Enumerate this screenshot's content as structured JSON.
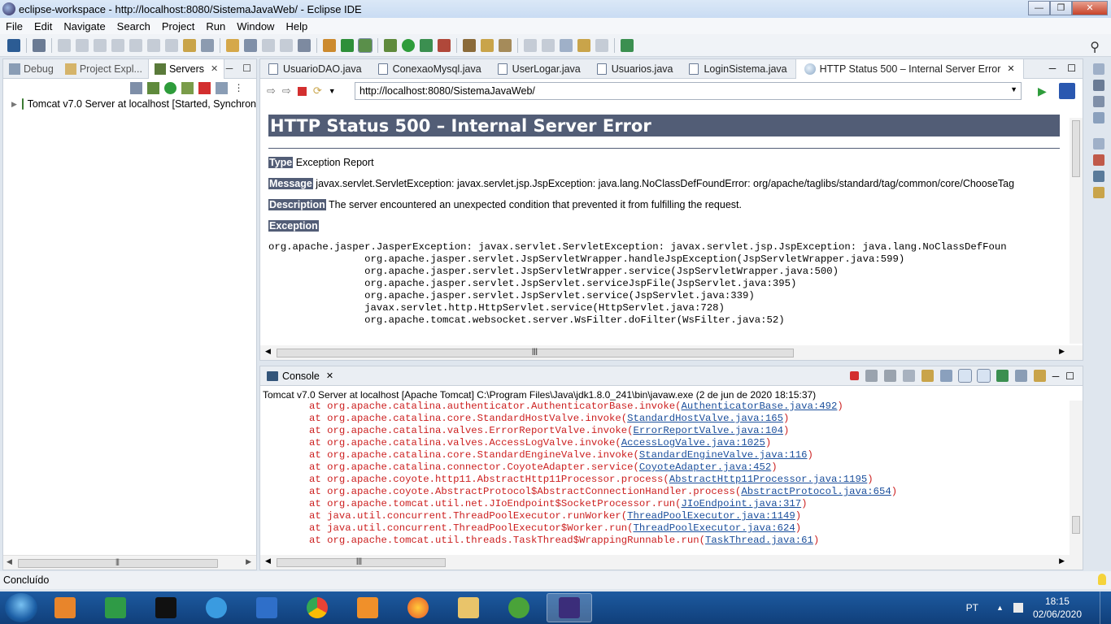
{
  "window": {
    "title": "eclipse-workspace - http://localhost:8080/SistemaJavaWeb/ - Eclipse IDE"
  },
  "menu": [
    "File",
    "Edit",
    "Navigate",
    "Search",
    "Project",
    "Run",
    "Window",
    "Help"
  ],
  "left_panel": {
    "tabs": [
      {
        "label": "Debug",
        "active": false
      },
      {
        "label": "Project Expl...",
        "active": false
      },
      {
        "label": "Servers",
        "active": true
      }
    ],
    "server_item": "Tomcat v7.0 Server at localhost  [Started, Synchron"
  },
  "editor": {
    "tabs": [
      {
        "label": "UsuarioDAO.java"
      },
      {
        "label": "ConexaoMysql.java"
      },
      {
        "label": "UserLogar.java"
      },
      {
        "label": "Usuarios.java"
      },
      {
        "label": "LoginSistema.java"
      },
      {
        "label": "HTTP Status 500 – Internal Server Error",
        "active": true
      }
    ],
    "url": "http://localhost:8080/SistemaJavaWeb/",
    "page": {
      "heading": "HTTP Status 500 – Internal Server Error",
      "type_label": "Type",
      "type_value": "Exception Report",
      "message_label": "Message",
      "message_value": "javax.servlet.ServletException: javax.servlet.jsp.JspException: java.lang.NoClassDefFoundError: org/apache/taglibs/standard/tag/common/core/ChooseTag",
      "description_label": "Description",
      "description_value": "The server encountered an unexpected condition that prevented it from fulfilling the request.",
      "exception_label": "Exception",
      "stack": [
        "org.apache.jasper.JasperException: javax.servlet.ServletException: javax.servlet.jsp.JspException: java.lang.NoClassDefFoun",
        "\torg.apache.jasper.servlet.JspServletWrapper.handleJspException(JspServletWrapper.java:599)",
        "\torg.apache.jasper.servlet.JspServletWrapper.service(JspServletWrapper.java:500)",
        "\torg.apache.jasper.servlet.JspServlet.serviceJspFile(JspServlet.java:395)",
        "\torg.apache.jasper.servlet.JspServlet.service(JspServlet.java:339)",
        "\tjavax.servlet.http.HttpServlet.service(HttpServlet.java:728)",
        "\torg.apache.tomcat.websocket.server.WsFilter.doFilter(WsFilter.java:52)"
      ]
    }
  },
  "console": {
    "tab_label": "Console",
    "title": "Tomcat v7.0 Server at localhost [Apache Tomcat] C:\\Program Files\\Java\\jdk1.8.0_241\\bin\\javaw.exe  (2 de jun de 2020 18:15:37)",
    "lines": [
      {
        "text": "at org.apache.catalina.authenticator.AuthenticatorBase.invoke(",
        "link": "AuthenticatorBase.java:492",
        "tail": ")"
      },
      {
        "text": "at org.apache.catalina.core.StandardHostValve.invoke(",
        "link": "StandardHostValve.java:165",
        "tail": ")"
      },
      {
        "text": "at org.apache.catalina.valves.ErrorReportValve.invoke(",
        "link": "ErrorReportValve.java:104",
        "tail": ")"
      },
      {
        "text": "at org.apache.catalina.valves.AccessLogValve.invoke(",
        "link": "AccessLogValve.java:1025",
        "tail": ")"
      },
      {
        "text": "at org.apache.catalina.core.StandardEngineValve.invoke(",
        "link": "StandardEngineValve.java:116",
        "tail": ")"
      },
      {
        "text": "at org.apache.catalina.connector.CoyoteAdapter.service(",
        "link": "CoyoteAdapter.java:452",
        "tail": ")"
      },
      {
        "text": "at org.apache.coyote.http11.AbstractHttp11Processor.process(",
        "link": "AbstractHttp11Processor.java:1195",
        "tail": ")"
      },
      {
        "text": "at org.apache.coyote.AbstractProtocol$AbstractConnectionHandler.process(",
        "link": "AbstractProtocol.java:654",
        "tail": ")"
      },
      {
        "text": "at org.apache.tomcat.util.net.JIoEndpoint$SocketProcessor.run(",
        "link": "JIoEndpoint.java:317",
        "tail": ")"
      },
      {
        "text": "at java.util.concurrent.ThreadPoolExecutor.runWorker(",
        "link": "ThreadPoolExecutor.java:1149",
        "tail": ")"
      },
      {
        "text": "at java.util.concurrent.ThreadPoolExecutor$Worker.run(",
        "link": "ThreadPoolExecutor.java:624",
        "tail": ")"
      },
      {
        "text": "at org.apache.tomcat.util.threads.TaskThread$WrappingRunnable.run(",
        "link": "TaskThread.java:61",
        "tail": ")"
      }
    ]
  },
  "status": {
    "text": "Concluído"
  },
  "taskbar": {
    "lang": "PT",
    "time": "18:15",
    "date": "02/06/2020",
    "apps": [
      "media-player",
      "spreadsheet",
      "cmd",
      "internet-explorer",
      "document",
      "chrome",
      "sublime",
      "firefox",
      "file-explorer",
      "utorrent",
      "eclipse"
    ]
  },
  "colors": {
    "error_header": "#525d76",
    "console_error": "#cc1f1f",
    "console_link": "#1b4f9c",
    "taskbar": "#1d5aa0"
  }
}
